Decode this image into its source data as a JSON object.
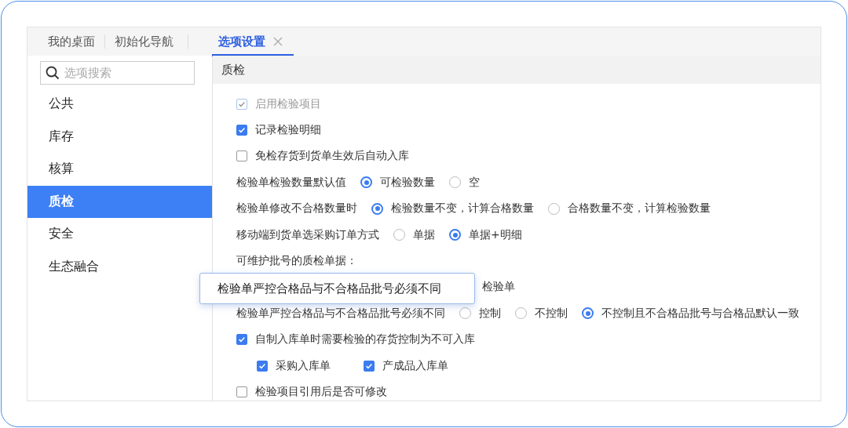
{
  "tabs": [
    {
      "label": "我的桌面",
      "selected": false,
      "closable": false
    },
    {
      "label": "初始化导航",
      "selected": false,
      "closable": false
    },
    {
      "label": "选项设置",
      "selected": true,
      "closable": true
    }
  ],
  "sidebar": {
    "search": {
      "placeholder": "选项搜索"
    },
    "items": [
      {
        "label": "公共",
        "selected": false
      },
      {
        "label": "库存",
        "selected": false
      },
      {
        "label": "核算",
        "selected": false
      },
      {
        "label": "质检",
        "selected": true
      },
      {
        "label": "安全",
        "selected": false
      },
      {
        "label": "生态融合",
        "selected": false
      }
    ]
  },
  "section": {
    "title": "质检"
  },
  "rows": [
    {
      "kind": "checkbox",
      "label": "启用检验项目",
      "checked": true,
      "disabled": true
    },
    {
      "kind": "checkbox",
      "label": "记录检验明细",
      "checked": true,
      "disabled": false
    },
    {
      "kind": "checkbox",
      "label": "免检存货到货单生效后自动入库",
      "checked": false,
      "disabled": false
    },
    {
      "kind": "radio",
      "label": "检验单检验数量默认值",
      "options": [
        {
          "label": "可检验数量",
          "selected": true
        },
        {
          "label": "空",
          "selected": false
        }
      ]
    },
    {
      "kind": "radio",
      "label": "检验单修改不合格数量时",
      "options": [
        {
          "label": "检验数量不变，计算合格数量",
          "selected": true
        },
        {
          "label": "合格数量不变，计算检验数量",
          "selected": false
        }
      ]
    },
    {
      "kind": "radio",
      "label": "移动端到货单选采购订单方式",
      "options": [
        {
          "label": "单据",
          "selected": false
        },
        {
          "label": "单据+明细",
          "selected": true
        }
      ]
    },
    {
      "kind": "text",
      "label": "可维护批号的质检单据："
    },
    {
      "kind": "obscured",
      "label": "检验单"
    },
    {
      "kind": "radio",
      "label": "检验单严控合格品与不合格品批号必须不同",
      "options": [
        {
          "label": "控制",
          "selected": false
        },
        {
          "label": "不控制",
          "selected": false
        },
        {
          "label": "不控制且不合格品批号与合格品默认一致",
          "selected": true
        }
      ]
    },
    {
      "kind": "checkbox",
      "label": "自制入库单时需要检验的存货控制为不可入库",
      "checked": true,
      "disabled": false,
      "children": [
        {
          "label": "采购入库单",
          "checked": true
        },
        {
          "label": "产成品入库单",
          "checked": true
        }
      ]
    },
    {
      "kind": "checkbox",
      "label": "检验项目引用后是否可修改",
      "checked": false,
      "disabled": false
    }
  ],
  "tooltip": {
    "text": "检验单严控合格品与不合格品批号必须不同"
  }
}
